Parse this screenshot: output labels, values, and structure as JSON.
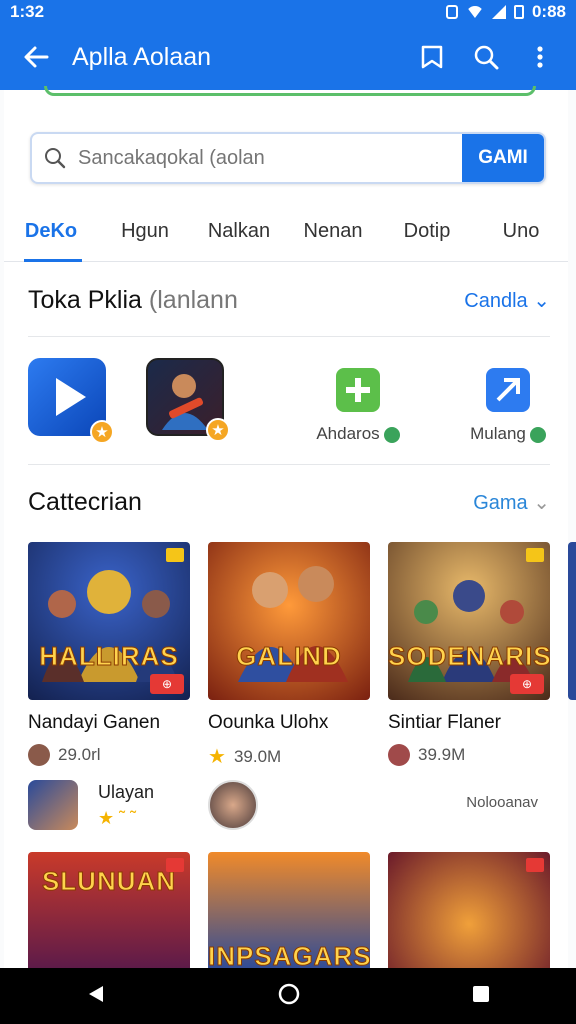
{
  "status_bar": {
    "time": "1:32",
    "right_text": "0:88"
  },
  "app_bar": {
    "title": "Aplla Aolaan"
  },
  "search": {
    "placeholder": "Sancakaqokal (aolan",
    "button_label": "GAMI"
  },
  "tabs": [
    {
      "label": "DeKo",
      "active": true
    },
    {
      "label": "Hgun",
      "active": false
    },
    {
      "label": "Nalkan",
      "active": false
    },
    {
      "label": "Nenan",
      "active": false
    },
    {
      "label": "Dotip",
      "active": false
    },
    {
      "label": "Uno",
      "active": false
    }
  ],
  "featured": {
    "title": "Toka Pklia",
    "subtitle": "(lanlann",
    "link": "Candla",
    "apps": [
      {
        "label": "Ahdaros"
      },
      {
        "label": "Mulang"
      }
    ]
  },
  "categories": {
    "title": "Cattecrian",
    "link": "Gama",
    "cards": [
      {
        "title": "Nandayi Ganen",
        "meta": "29.0rl",
        "art_text": "HALLIRAS"
      },
      {
        "title": "Oounka Ulohx",
        "meta": "39.0M",
        "art_text": "GALIND"
      },
      {
        "title": "Sintiar Flaner",
        "meta": "39.9M",
        "art_text": "SODENARIS"
      }
    ]
  },
  "mini_row": {
    "name": "Ulayan",
    "right_text": "Nolooanav"
  },
  "bottom_cards": [
    {
      "art_text": "SLUNUAN"
    },
    {
      "art_text": "INPSAGARS"
    },
    {
      "art_text": ""
    }
  ],
  "colors": {
    "primary": "#1a73e8",
    "badge_star": "#f5a623",
    "badge_red": "#e53935"
  }
}
